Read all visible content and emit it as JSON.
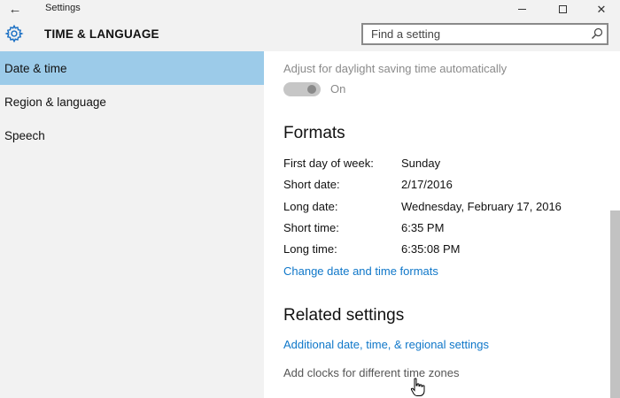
{
  "window": {
    "app_title": "Settings",
    "controls": {
      "back_icon": "left-arrow-icon",
      "minimize_icon": "minimize-icon",
      "maximize_icon": "maximize-icon",
      "close_icon": "close-icon"
    }
  },
  "header": {
    "title": "TIME & LANGUAGE",
    "icon": "gear-icon",
    "search": {
      "placeholder": "Find a setting",
      "value": ""
    }
  },
  "sidebar": {
    "items": [
      {
        "label": "Date & time",
        "selected": true
      },
      {
        "label": "Region & language",
        "selected": false
      },
      {
        "label": "Speech",
        "selected": false
      }
    ]
  },
  "content": {
    "daylight": {
      "label": "Adjust for daylight saving time automatically",
      "state": "On",
      "enabled": false
    },
    "formats": {
      "title": "Formats",
      "rows": [
        {
          "label": "First day of week:",
          "value": "Sunday"
        },
        {
          "label": "Short date:",
          "value": "2/17/2016"
        },
        {
          "label": "Long date:",
          "value": "Wednesday, February 17, 2016"
        },
        {
          "label": "Short time:",
          "value": "6:35 PM"
        },
        {
          "label": "Long time:",
          "value": "6:35:08 PM"
        }
      ],
      "change_link": "Change date and time formats"
    },
    "related": {
      "title": "Related settings",
      "additional_link": "Additional date, time, & regional settings",
      "clocks_link": "Add clocks for different time zones"
    }
  },
  "colors": {
    "accent": "#0f77c9",
    "selected_nav": "#9ccbe9",
    "chrome": "#f2f2f2"
  }
}
